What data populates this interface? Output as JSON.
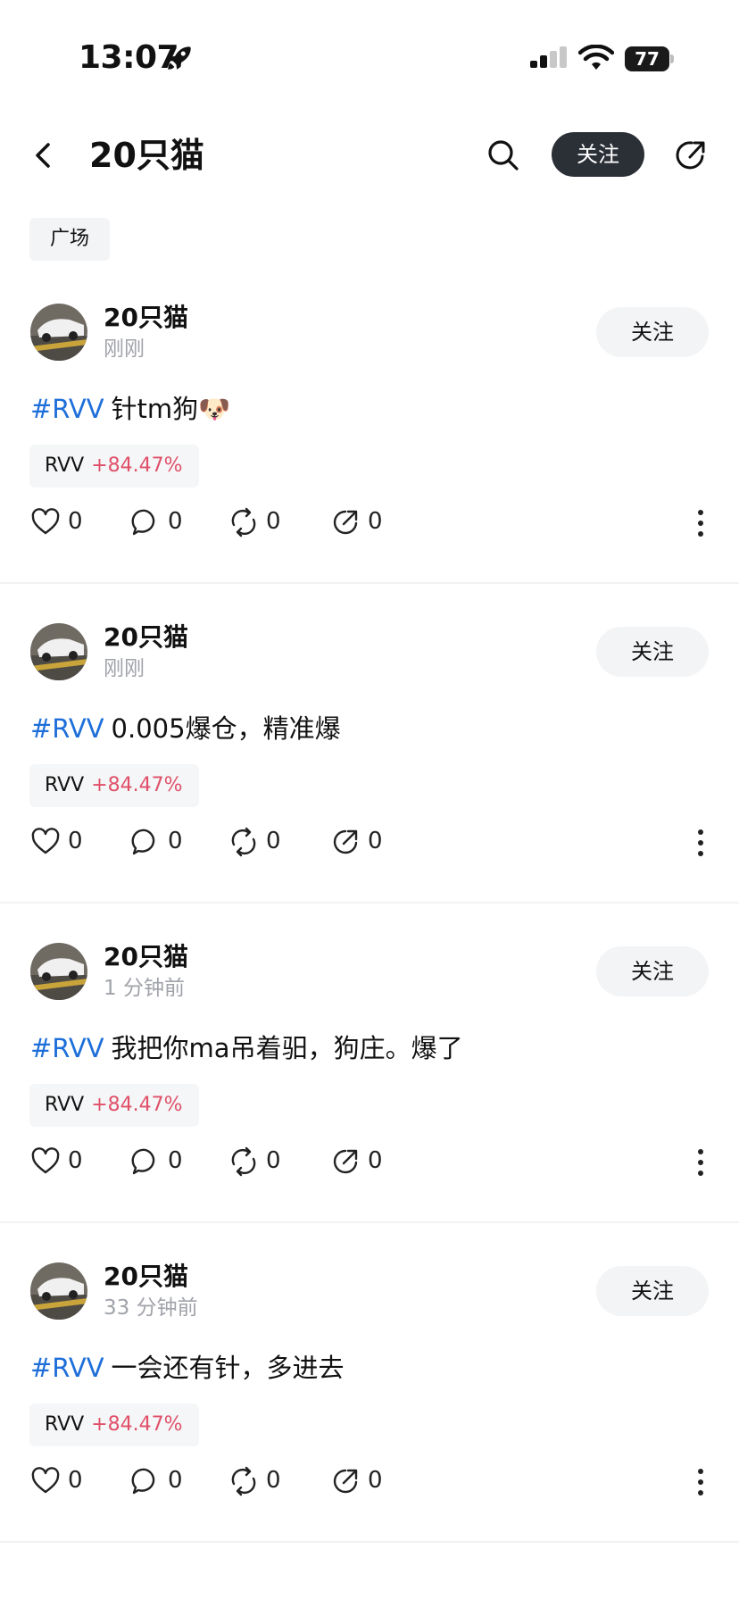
{
  "status_bar": {
    "time": "13:07",
    "battery": "77"
  },
  "header": {
    "title": "20只猫",
    "follow_label": "关注"
  },
  "tabs": {
    "plaza": "广场"
  },
  "posts": [
    {
      "author": "20只猫",
      "time": "刚刚",
      "follow_label": "关注",
      "tag": "#RVV",
      "text": "针tm狗🐶",
      "ticker": "RVV",
      "change": "+84.47%",
      "likes": "0",
      "comments": "0",
      "reposts": "0",
      "shares": "0"
    },
    {
      "author": "20只猫",
      "time": "刚刚",
      "follow_label": "关注",
      "tag": "#RVV",
      "text": "0.005爆仓，精准爆",
      "ticker": "RVV",
      "change": "+84.47%",
      "likes": "0",
      "comments": "0",
      "reposts": "0",
      "shares": "0"
    },
    {
      "author": "20只猫",
      "time": "1 分钟前",
      "follow_label": "关注",
      "tag": "#RVV",
      "text": "我把你ma吊着驲，狗庄。爆了",
      "ticker": "RVV",
      "change": "+84.47%",
      "likes": "0",
      "comments": "0",
      "reposts": "0",
      "shares": "0"
    },
    {
      "author": "20只猫",
      "time": "33 分钟前",
      "follow_label": "关注",
      "tag": "#RVV",
      "text": "一会还有针，多进去",
      "ticker": "RVV",
      "change": "+84.47%",
      "likes": "0",
      "comments": "0",
      "reposts": "0",
      "shares": "0"
    }
  ],
  "colors": {
    "hashtag": "#1e6fd9",
    "gain": "#e0506a",
    "primary_button": "#2b2f36"
  },
  "icons": [
    "back-icon",
    "search-icon",
    "share-icon",
    "heart-icon",
    "comment-icon",
    "repost-icon",
    "more-icon",
    "rocket-icon",
    "signal-icon",
    "wifi-icon",
    "battery-icon"
  ]
}
